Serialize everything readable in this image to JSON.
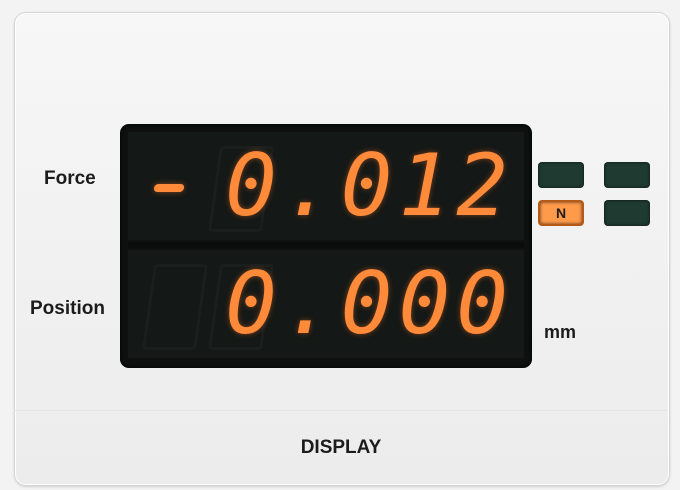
{
  "labels": {
    "force": "Force",
    "position": "Position",
    "unit_mm": "mm",
    "display_button": "DISPLAY"
  },
  "readouts": {
    "force_sign": "-",
    "force_value": "0.012",
    "position_value": "0.000"
  },
  "indicators": {
    "force_unit_active": "N"
  },
  "colors": {
    "digit": "#ff8a3a",
    "screen": "#0e1110",
    "indicator_off": "#1f3a30",
    "indicator_on": "#ff9a4a"
  }
}
